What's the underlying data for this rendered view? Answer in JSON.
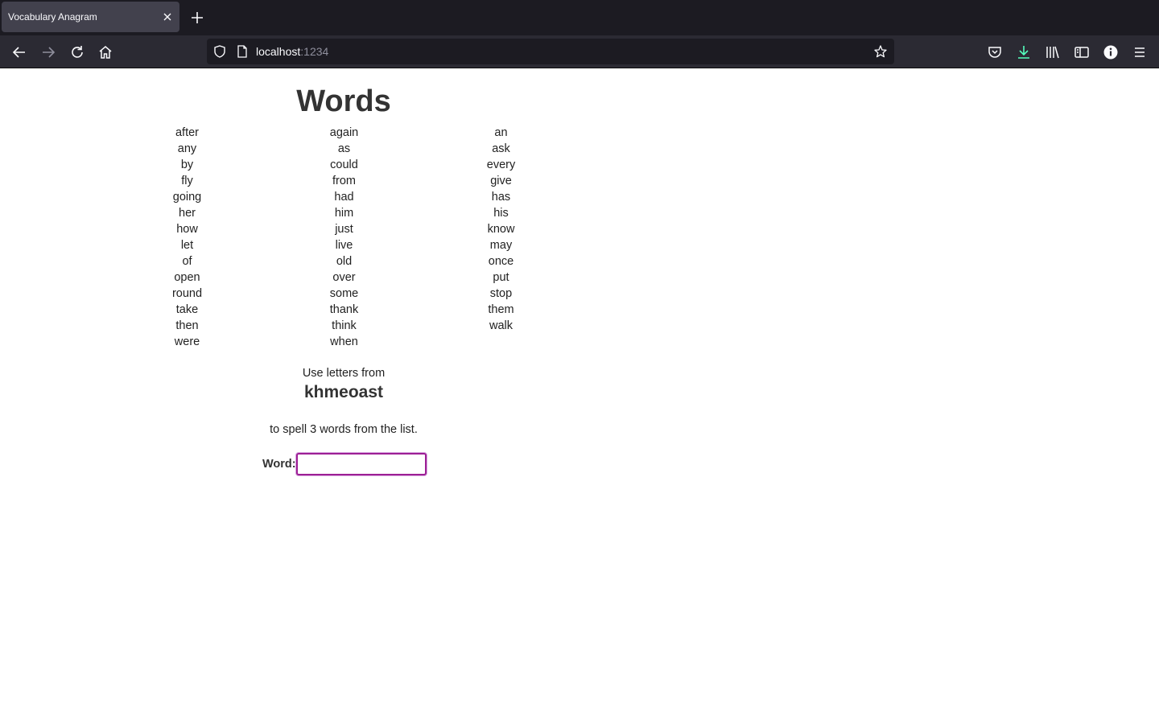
{
  "browser": {
    "tab_title": "Vocabulary Anagram",
    "url_host": "localhost",
    "url_port": ":1234"
  },
  "page": {
    "heading": "Words",
    "words": [
      "after",
      "again",
      "an",
      "any",
      "as",
      "ask",
      "by",
      "could",
      "every",
      "fly",
      "from",
      "give",
      "going",
      "had",
      "has",
      "her",
      "him",
      "his",
      "how",
      "just",
      "know",
      "let",
      "live",
      "may",
      "of",
      "old",
      "once",
      "open",
      "over",
      "put",
      "round",
      "some",
      "stop",
      "take",
      "thank",
      "them",
      "then",
      "think",
      "walk",
      "were",
      "when",
      ""
    ],
    "instruction_top": "Use letters from",
    "letters": "khmeoast",
    "instruction_bottom": "to spell 3 words from the list.",
    "word_label": "Word:",
    "word_value": ""
  },
  "icons": {
    "accent": "#9d1f95",
    "download_color": "#54ffbd"
  }
}
